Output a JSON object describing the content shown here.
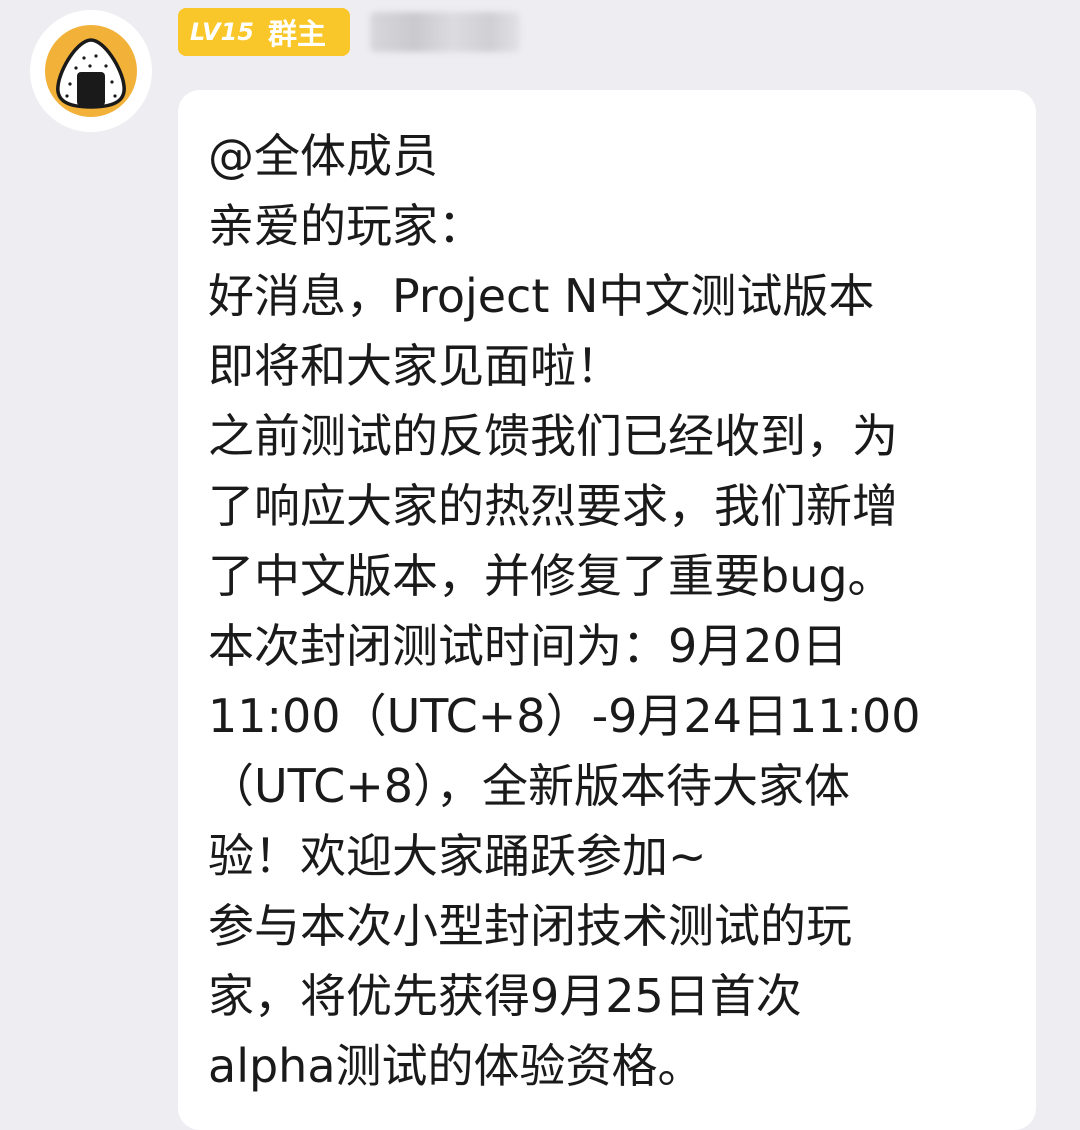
{
  "sender": {
    "avatar_icon": "onigiri-icon",
    "level": "LV15",
    "role": "群主"
  },
  "message": {
    "lines": [
      "@全体成员",
      "亲爱的玩家：",
      "好消息，Project N中文测试版本",
      "即将和大家见面啦！",
      "之前测试的反馈我们已经收到，为",
      "了响应大家的热烈要求，我们新增",
      "了中文版本，并修复了重要bug。",
      "本次封闭测试时间为：9月20日",
      "11:00（UTC+8）-9月24日11:00",
      "（UTC+8），全新版本待大家体",
      "验！欢迎大家踊跃参加~",
      "参与本次小型封闭技术测试的玩",
      "家，将优先获得9月25日首次",
      "alpha测试的体验资格。"
    ]
  },
  "colors": {
    "background": "#eeeef2",
    "bubble": "#ffffff",
    "badge": "#f9c72a",
    "avatar_ring": "#f2b23a",
    "text": "#1a1a1a"
  }
}
